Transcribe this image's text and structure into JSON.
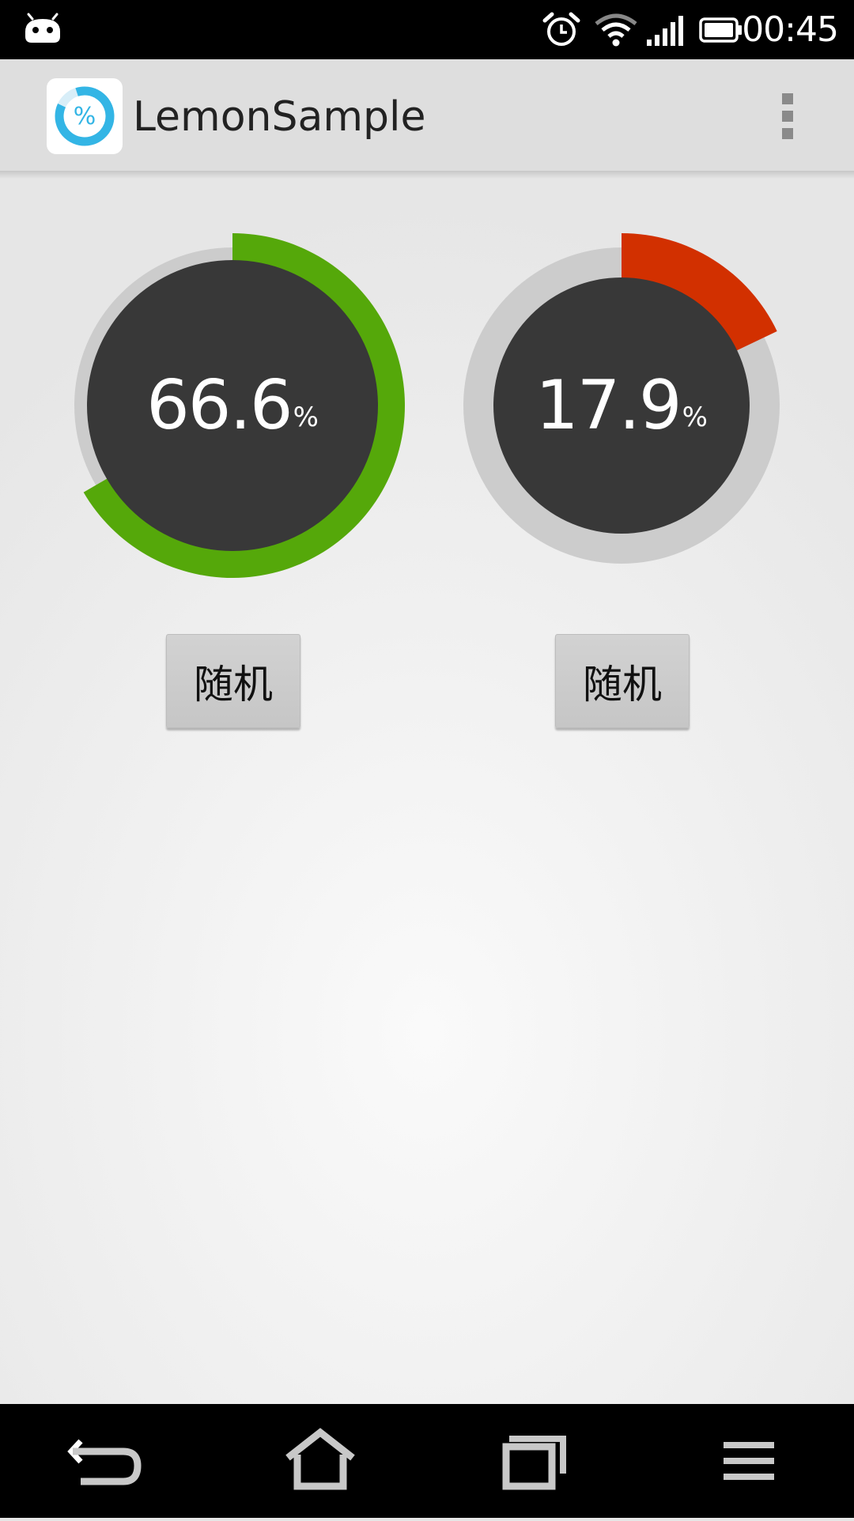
{
  "status_bar": {
    "time": "00:45",
    "icons": [
      "android-notification-icon",
      "alarm-icon",
      "wifi-icon",
      "signal-icon",
      "battery-icon"
    ]
  },
  "action_bar": {
    "app_icon": "percent-ring-icon",
    "app_icon_glyph": "%",
    "title": "LemonSample",
    "overflow_icon": "overflow-menu-icon"
  },
  "gauges": [
    {
      "value": "66.6",
      "unit": "%",
      "fraction": 0.666,
      "color": "#55a80a",
      "track_color": "#cccccc",
      "disc_color": "#383838"
    },
    {
      "value": "17.9",
      "unit": "%",
      "fraction": 0.179,
      "color": "#d23000",
      "track_color": "#cccccc",
      "disc_color": "#383838"
    }
  ],
  "buttons": [
    {
      "label": "随机"
    },
    {
      "label": "随机"
    }
  ],
  "nav_bar": {
    "icons": [
      "back-icon",
      "home-icon",
      "recent-apps-icon",
      "menu-icon"
    ]
  },
  "colors": {
    "app_accent": "#33b5e5"
  }
}
